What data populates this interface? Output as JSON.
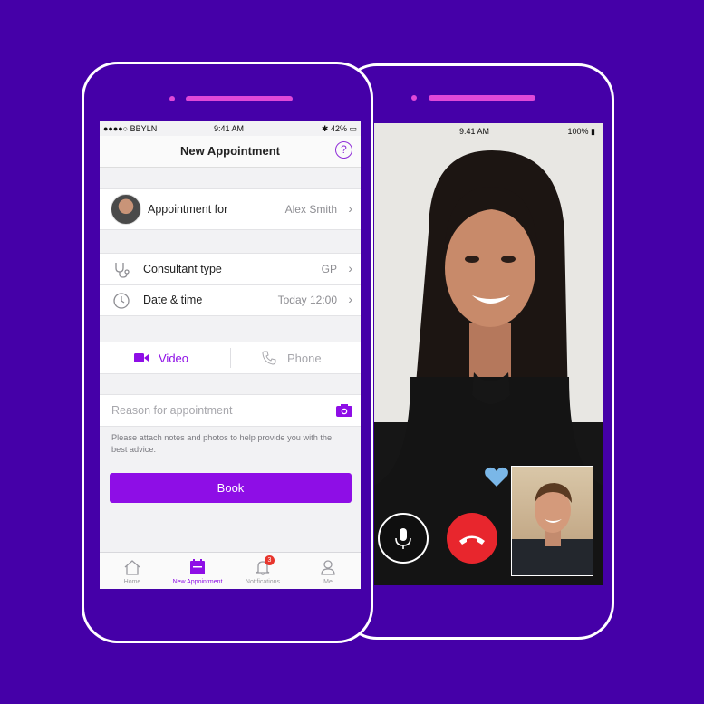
{
  "colors": {
    "background": "#4500a8",
    "accent": "#8e0ee6",
    "frame": "#ffffff",
    "end_call": "#e8262d"
  },
  "left_phone": {
    "status": {
      "carrier": "●●●●○ BBYLN",
      "time": "9:41 AM",
      "battery": "42%"
    },
    "nav_title": "New Appointment",
    "help_icon": "?",
    "appointment_for": {
      "label": "Appointment for",
      "value": "Alex Smith"
    },
    "consultant_type": {
      "label": "Consultant type",
      "value": "GP",
      "icon": "stethoscope-icon"
    },
    "date_time": {
      "label": "Date & time",
      "value": "Today 12:00",
      "icon": "clock-icon"
    },
    "mode_tabs": [
      {
        "label": "Video",
        "icon": "video-camera-icon",
        "selected": true
      },
      {
        "label": "Phone",
        "icon": "phone-icon",
        "selected": false
      }
    ],
    "reason_placeholder": "Reason for appointment",
    "hint": "Please attach notes and photos to help provide you with the best advice.",
    "book_label": "Book",
    "tabbar": [
      {
        "label": "Home",
        "icon": "home-icon"
      },
      {
        "label": "New Appointment",
        "icon": "calendar-icon",
        "active": true
      },
      {
        "label": "Notifications",
        "icon": "bell-icon",
        "badge": "3"
      },
      {
        "label": "Me",
        "icon": "person-icon"
      }
    ]
  },
  "right_phone": {
    "status": {
      "time": "9:41 AM",
      "battery": "100%"
    },
    "controls": [
      "microphone-icon",
      "end-call-icon"
    ]
  }
}
